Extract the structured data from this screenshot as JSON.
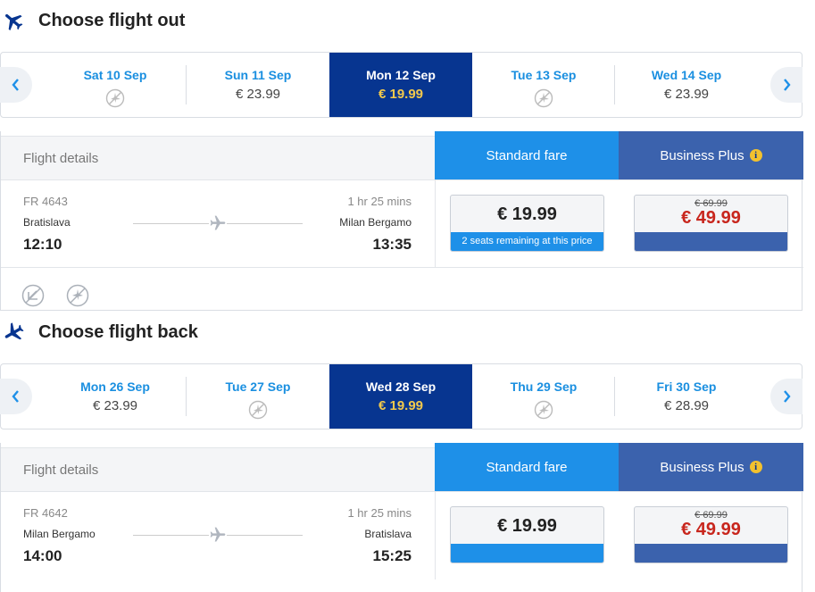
{
  "outbound": {
    "title": "Choose flight out",
    "days": [
      {
        "label": "Sat 10 Sep",
        "price": "",
        "available": false
      },
      {
        "label": "Sun 11 Sep",
        "price": "€ 23.99",
        "available": true
      },
      {
        "label": "Mon 12 Sep",
        "price": "€ 19.99",
        "available": true,
        "selected": true
      },
      {
        "label": "Tue 13 Sep",
        "price": "",
        "available": false
      },
      {
        "label": "Wed 14 Sep",
        "price": "€ 23.99",
        "available": true
      }
    ],
    "details_label": "Flight details",
    "standard_label": "Standard fare",
    "business_label": "Business Plus",
    "flight": {
      "number": "FR 4643",
      "duration": "1 hr 25 mins",
      "from": "Bratislava",
      "to": "Milan Bergamo",
      "depart": "12:10",
      "arrive": "13:35"
    },
    "standard_price": "€ 19.99",
    "standard_note": "2 seats remaining at this price",
    "business_old_price": "€ 69.99",
    "business_price": "€ 49.99"
  },
  "return": {
    "title": "Choose flight back",
    "days": [
      {
        "label": "Mon 26 Sep",
        "price": "€ 23.99",
        "available": true
      },
      {
        "label": "Tue 27 Sep",
        "price": "",
        "available": false
      },
      {
        "label": "Wed 28 Sep",
        "price": "€ 19.99",
        "available": true,
        "selected": true
      },
      {
        "label": "Thu 29 Sep",
        "price": "",
        "available": false
      },
      {
        "label": "Fri 30 Sep",
        "price": "€ 28.99",
        "available": true
      }
    ],
    "details_label": "Flight details",
    "standard_label": "Standard fare",
    "business_label": "Business Plus",
    "flight": {
      "number": "FR 4642",
      "duration": "1 hr 25 mins",
      "from": "Milan Bergamo",
      "to": "Bratislava",
      "depart": "14:00",
      "arrive": "15:25"
    },
    "standard_price": "€ 19.99",
    "standard_note": "",
    "business_old_price": "€ 69.99",
    "business_price": "€ 49.99"
  },
  "info_glyph": "i",
  "colors": {
    "selected_day": "#073590",
    "standard_fare": "#1e90e8",
    "business_fare": "#3b62ad",
    "day_label": "#1a8fe0",
    "selected_price": "#f2c94c",
    "business_price": "#c8261d"
  }
}
